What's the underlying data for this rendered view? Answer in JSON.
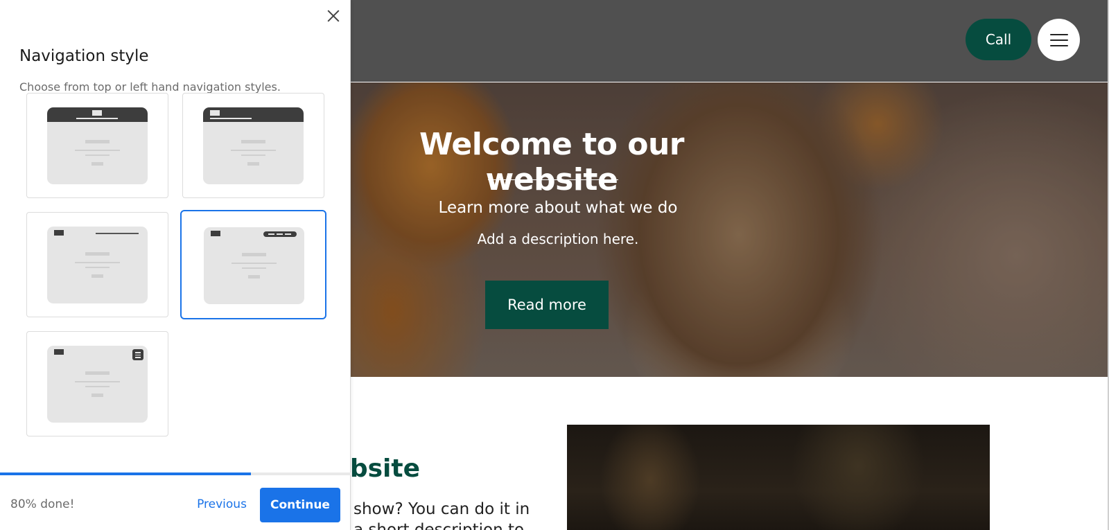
{
  "panel": {
    "title": "Navigation style",
    "subtitle": "Choose from top or left hand navigation styles.",
    "close_icon": "close-icon",
    "options": [
      {
        "name": "top-centered-nav",
        "selected": false
      },
      {
        "name": "top-left-nav",
        "selected": false
      },
      {
        "name": "top-right-links-nav",
        "selected": false
      },
      {
        "name": "top-right-pill-nav",
        "selected": true
      },
      {
        "name": "hamburger-menu-nav",
        "selected": false
      }
    ],
    "progress_percent": 80,
    "progress_label": "80% done!",
    "previous_label": "Previous",
    "continue_label": "Continue",
    "accent_color": "#1a73e8"
  },
  "site": {
    "call_label": "Call",
    "menu_icon": "hamburger-menu-icon",
    "hero_title": "Welcome to our website",
    "hero_subtitle": "Learn more about what we do",
    "hero_description": "Add a description here.",
    "read_more_label": "Read more",
    "about_title_partial": "bsite",
    "about_body_line1": "show? You can do it in",
    "about_body_line2": "a short description to",
    "brand_color": "#064c3f",
    "header_color": "#505050"
  }
}
